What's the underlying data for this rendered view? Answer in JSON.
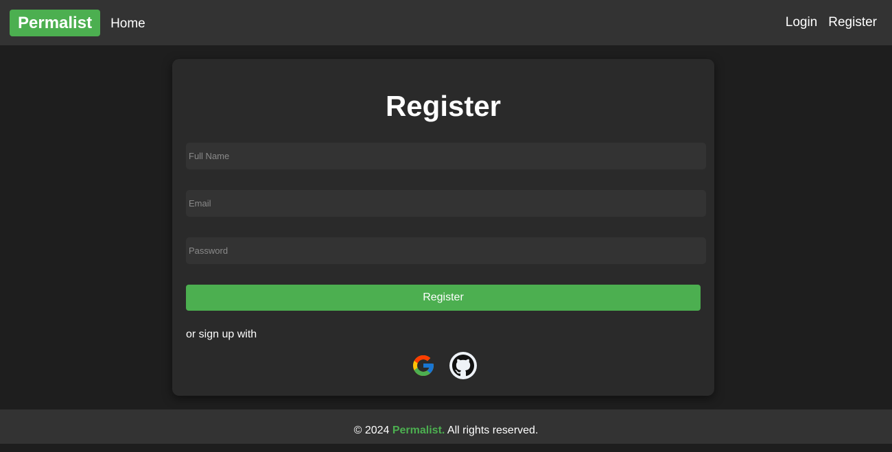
{
  "navbar": {
    "brand": "Permalist",
    "home": "Home",
    "login": "Login",
    "register": "Register"
  },
  "form": {
    "title": "Register",
    "full_name_placeholder": "Full Name",
    "email_placeholder": "Email",
    "password_placeholder": "Password",
    "submit_label": "Register",
    "alt_text": "or sign up with",
    "social_icons": [
      "google-icon",
      "github-icon"
    ]
  },
  "footer": {
    "prefix": "© 2024 ",
    "brand": "Permalist.",
    "suffix": " All rights reserved."
  },
  "colors": {
    "accent": "#4caf50",
    "background": "#1e1e1e",
    "navbar": "#333333",
    "card": "#2a2a2a"
  }
}
